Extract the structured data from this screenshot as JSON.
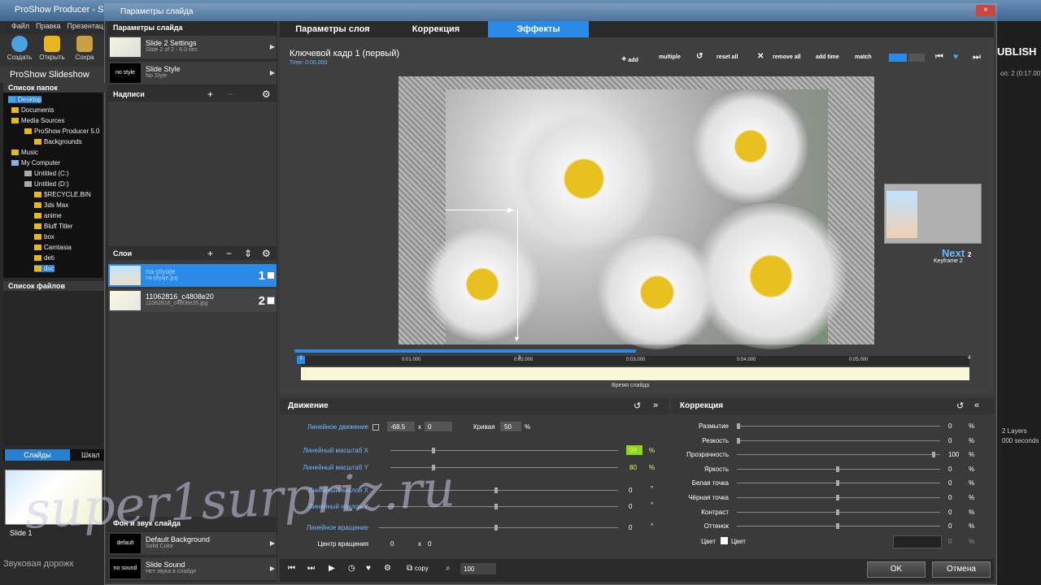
{
  "app": {
    "window_title": "ProShow Producer - Silence",
    "menu": [
      "Файл",
      "Правка",
      "Презентац"
    ],
    "toolbar": [
      "Создать",
      "Открыть",
      "Сохра"
    ],
    "app_title": "ProShow Slideshow",
    "folders_header": "Список папок",
    "folders": [
      "Desktop",
      "Documents",
      "Media Sources",
      "ProShow Producer 5.0",
      "Backgrounds",
      "Music",
      "My Computer",
      "Untitled (C:)",
      "Untitled (D:)",
      "$RECYCLE.BIN",
      "3ds Max",
      "anime",
      "Bluff Titler",
      "box",
      "Camtasia",
      "deti",
      "doc"
    ],
    "files_header": "Список файлов",
    "slides_tab": "Слайды",
    "scale_tab": "Шкал",
    "slide_label": "Slide 1",
    "sound_track": "Звуковая дорожк",
    "publish": "UBLISH",
    "right_info": "оп: 2 (0:17.00)",
    "layers_info": "2 Layers",
    "secs_info": "000 seconds"
  },
  "dialog": {
    "title": "Параметры слайда",
    "close_icon": "×",
    "left": {
      "header": "Параметры слайда",
      "settings": {
        "title": "Slide 2 Settings",
        "sub": "Slide 2 of 2 - 6.0 sec"
      },
      "style": {
        "title": "Slide Style",
        "sub": "No Style",
        "thumb": "no style"
      },
      "captions_header": "Надписи",
      "layers_header": "Слои",
      "layers": [
        {
          "name": "na-plyaje",
          "file": "na-plyaje.jpg",
          "num": "1"
        },
        {
          "name": "11062816_c4808e20",
          "file": "11062816_c4808e20.jpg",
          "num": "2"
        }
      ],
      "bgsound_header": "Фон и звук слайда",
      "background": {
        "title": "Default Background",
        "sub": "Solid Color",
        "thumb": "default"
      },
      "sound": {
        "title": "Slide Sound",
        "sub": "Нет звука в слайде",
        "thumb": "no sound"
      }
    },
    "tabs": [
      "Параметры слоя",
      "Коррекция",
      "Эффекты"
    ],
    "keyframe": {
      "title": "Ключевой кадр 1 (первый)",
      "time": "Time: 0:00.000",
      "buttons": [
        "add",
        "multiple",
        "reset all",
        "remove all",
        "add time",
        "match"
      ],
      "next": "Next",
      "next_num": "2",
      "next_sub": "Keyframe 2"
    },
    "timeline": {
      "ticks": [
        "0:01.000",
        "0:02.000",
        "0:03.000",
        "0:04.000",
        "0:05.000"
      ],
      "label": "Время слайда",
      "start_marker": "1",
      "end_marker": "4",
      "mid_marker": "3"
    },
    "motion": {
      "title": "Движение",
      "rows": [
        {
          "label": "Линейное движение",
          "x": "-68.5",
          "y": "0",
          "extra_label": "Кривая",
          "extra_val": "50",
          "unit": "%"
        },
        {
          "label": "Линейный масштаб X",
          "val": "99",
          "unit": "%"
        },
        {
          "label": "Линейный масштаб Y",
          "val": "80",
          "unit": "%"
        },
        {
          "label": "Линейный наклон X",
          "val": "0",
          "unit": "°"
        },
        {
          "label": "Линейный наклон Y",
          "val": "0",
          "unit": "°"
        },
        {
          "label": "Линейное вращение",
          "val": "0",
          "unit": "°"
        },
        {
          "label": "Центр вращения",
          "x": "0",
          "y": "0"
        }
      ]
    },
    "correction": {
      "title": "Коррекция",
      "rows": [
        {
          "label": "Размытие",
          "val": "0"
        },
        {
          "label": "Резкость",
          "val": "0"
        },
        {
          "label": "Прозрачность",
          "val": "100"
        },
        {
          "label": "Яркость",
          "val": "0"
        },
        {
          "label": "Белая точка",
          "val": "0"
        },
        {
          "label": "Чёрная точка",
          "val": "0"
        },
        {
          "label": "Контраст",
          "val": "0"
        },
        {
          "label": "Оттенок",
          "val": "0"
        }
      ],
      "color_label": "Цвет",
      "color_check_label": "Цвет",
      "color_val": "0",
      "unit": "%"
    },
    "bottom": {
      "copy": "copy",
      "zoom": "100",
      "ok": "OK",
      "cancel": "Отмена"
    }
  },
  "watermark": "super1surpriz.ru"
}
